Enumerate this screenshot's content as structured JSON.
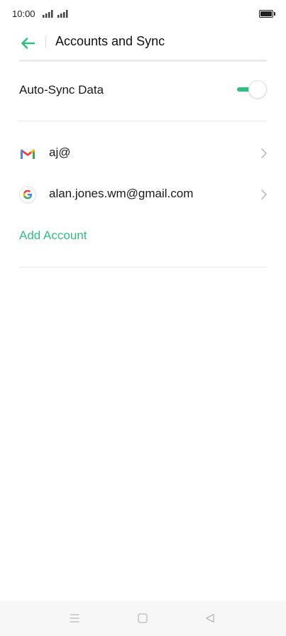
{
  "status_bar": {
    "time": "10:00"
  },
  "header": {
    "title": "Accounts and Sync"
  },
  "settings": {
    "auto_sync_label": "Auto-Sync Data",
    "auto_sync_on": true
  },
  "accounts": [
    {
      "label": "aj@",
      "icon": "gmail-icon"
    },
    {
      "label": "alan.jones.wm@gmail.com",
      "icon": "google-icon"
    }
  ],
  "add_account_label": "Add Account",
  "colors": {
    "accent": "#2fbf7f",
    "gmail_red": "#ea4335",
    "gmail_blue": "#4285f4",
    "gmail_green": "#34a853",
    "gmail_yellow": "#fbbc04"
  }
}
